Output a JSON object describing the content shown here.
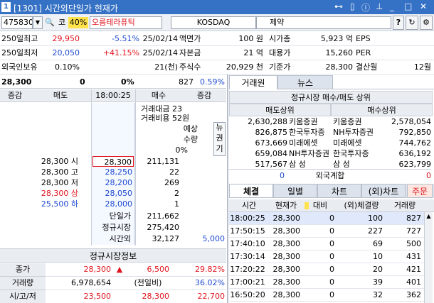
{
  "window": {
    "badge": "1",
    "title": "[1301] 시간외단일가 현재가"
  },
  "toolbar": {
    "code": "475830",
    "market_label": "코",
    "margin": "40%",
    "name": "오름테라퓨틱",
    "exchange": "KOSDAQ",
    "sector": "제약",
    "help": "?",
    "refresh": "↻",
    "settings": "⚙"
  },
  "info": [
    {
      "l1": "250일최고",
      "v1": "29,950",
      "p1": "-5.51%",
      "d1": "25/02/14",
      "l2": "액면가",
      "v2": "100 원",
      "l3": "시가총",
      "v3": "5,923 억",
      "l4": "EPS",
      "v4": ""
    },
    {
      "l1": "250일최저",
      "v1": "20,050",
      "p1": "+41.15%",
      "d1": "25/02/14",
      "l2": "자본금",
      "v2": "21 억",
      "l3": "대용가",
      "v3": "15,260",
      "l4": "PER",
      "v4": ""
    },
    {
      "l1": "외국인보유",
      "v1": "0.10%",
      "p1": "",
      "d1": "21(천)",
      "l2": "주식수",
      "v2": "20,929 천",
      "l3": "기준가",
      "v3": "28,300",
      "l4": "결산월",
      "v4": "12월"
    }
  ],
  "quote": {
    "price": "28,300",
    "change": "0",
    "rate": "0%",
    "vol": "827",
    "vol_rate": "0.59%"
  },
  "orderbook": {
    "headers": [
      "증감",
      "매도",
      "18:00:25",
      "매수",
      "증감"
    ],
    "amount": "거래대금 23",
    "cost": "거래비용 52원",
    "expected": "예상",
    "qty": "수량",
    "pct": "0%",
    "news": [
      "뉴",
      "권",
      "기"
    ],
    "rows": [
      {
        "label": "28,300 시",
        "price": "28,300",
        "qty": "211,131"
      },
      {
        "label": "28,300 고",
        "price": "28,250",
        "qty": "22"
      },
      {
        "label": "28,300 저",
        "price": "28,200",
        "qty": "269"
      },
      {
        "label": "28,300 상",
        "price": "28,050",
        "qty": "2"
      },
      {
        "label": "25,500 하",
        "price": "28,000",
        "qty": "1"
      }
    ],
    "summary": [
      {
        "k": "단일가",
        "v": "211,662",
        "x": ""
      },
      {
        "k": "정규시장",
        "v": "275,420",
        "x": ""
      },
      {
        "k": "시간외",
        "v": "32,127",
        "x": "5,000"
      }
    ]
  },
  "regular": {
    "title": "정규시장정보",
    "rows": [
      {
        "k": "종가",
        "a": "28,300",
        "arrow": "▲",
        "b": "6,500",
        "c": "29.82%"
      },
      {
        "k": "거래량",
        "a": "6,978,654",
        "arrow": "",
        "b": "(전일비)",
        "c": "36.02%"
      },
      {
        "k": "시/고/저",
        "a": "23,500",
        "arrow": "",
        "b": "28,300",
        "c": "22,700"
      }
    ]
  },
  "broker": {
    "tabs": [
      "거래원",
      "뉴스"
    ],
    "title": "정규시장 매수/매도 상위",
    "sell_title": "매도상위",
    "buy_title": "매수상위",
    "rows": [
      {
        "sq": "2,630,288",
        "sn": "키움증권",
        "bn": "키움증권",
        "bq": "2,578,054"
      },
      {
        "sq": "826,875",
        "sn": "한국투자증",
        "bn": "NH투자증권",
        "bq": "792,850"
      },
      {
        "sq": "673,669",
        "sn": "미래에셋",
        "bn": "미래에셋",
        "bq": "744,762"
      },
      {
        "sq": "659,084",
        "sn": "NH투자증권",
        "bn": "한국투자증",
        "bq": "636,192"
      },
      {
        "sq": "517,567",
        "sn": "삼  성",
        "bn": "삼  성",
        "bq": "623,799"
      }
    ],
    "foreign": {
      "l": "0",
      "label": "외국계합",
      "r": "0"
    }
  },
  "ticks": {
    "tabs": [
      "체결",
      "일별",
      "차트",
      "(외)차트"
    ],
    "order": "주문",
    "headers": [
      "시간",
      "현재가",
      "대비",
      "(외)체결량",
      "거래량"
    ],
    "rows": [
      {
        "t": "18:00:25",
        "p": "28,300",
        "d": "0",
        "q": "100",
        "v": "827"
      },
      {
        "t": "17:50:15",
        "p": "28,300",
        "d": "0",
        "q": "227",
        "v": "727"
      },
      {
        "t": "17:40:10",
        "p": "28,300",
        "d": "0",
        "q": "69",
        "v": "500"
      },
      {
        "t": "17:30:14",
        "p": "28,300",
        "d": "0",
        "q": "10",
        "v": "431"
      },
      {
        "t": "17:20:22",
        "p": "28,300",
        "d": "0",
        "q": "20",
        "v": "421"
      },
      {
        "t": "17:00:21",
        "p": "28,300",
        "d": "0",
        "q": "39",
        "v": "401"
      },
      {
        "t": "16:50:20",
        "p": "28,300",
        "d": "0",
        "q": "32",
        "v": "362"
      }
    ]
  }
}
